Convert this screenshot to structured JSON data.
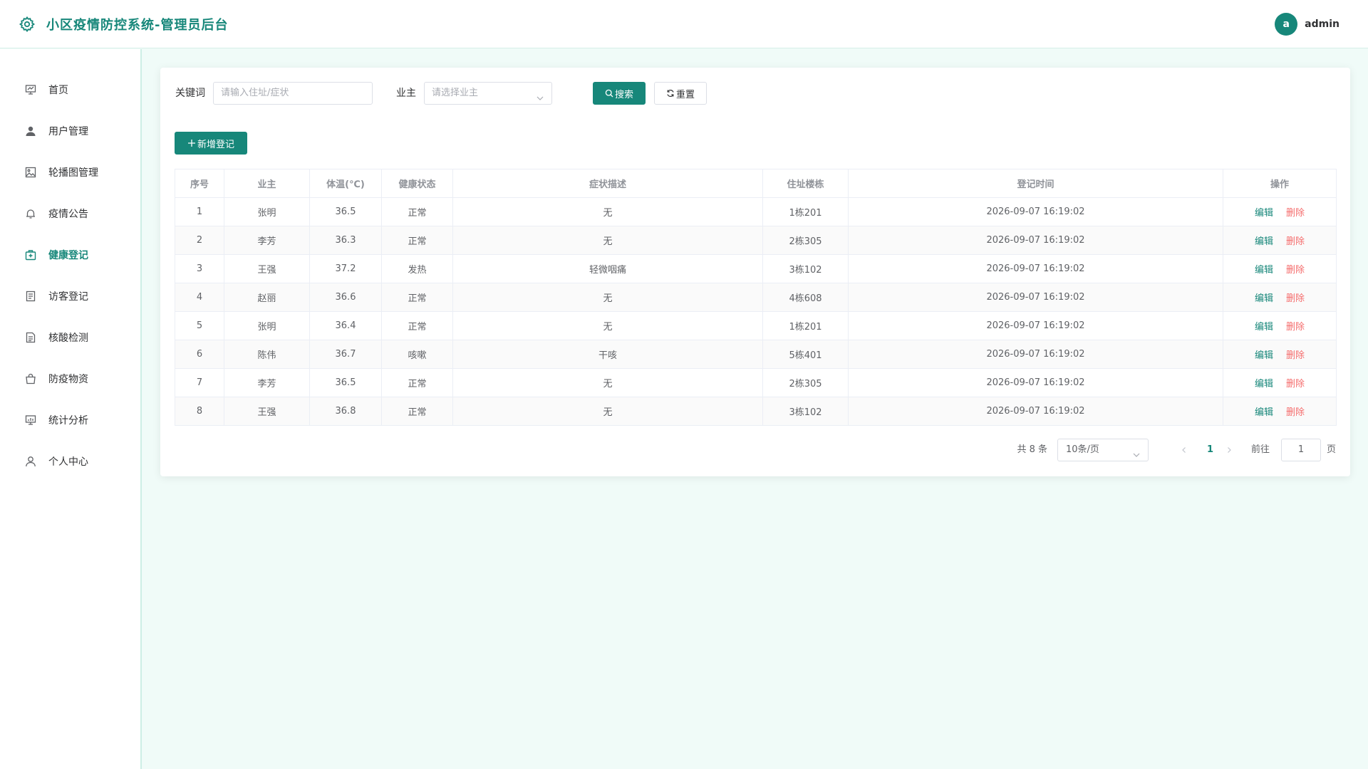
{
  "app": {
    "title": "小区疫情防控系统-管理员后台",
    "accent": "#17877a"
  },
  "user": {
    "avatar_letter": "a",
    "name": "admin"
  },
  "sidebar": {
    "items": [
      {
        "label": "首页",
        "icon": "dashboard-icon"
      },
      {
        "label": "用户管理",
        "icon": "user-icon"
      },
      {
        "label": "轮播图管理",
        "icon": "image-icon"
      },
      {
        "label": "疫情公告",
        "icon": "bell-icon"
      },
      {
        "label": "健康登记",
        "icon": "first-aid-kit-icon",
        "active": true
      },
      {
        "label": "访客登记",
        "icon": "document-icon"
      },
      {
        "label": "核酸检测",
        "icon": "tickets-icon"
      },
      {
        "label": "防疫物资",
        "icon": "bag-icon"
      },
      {
        "label": "统计分析",
        "icon": "data-analysis-icon"
      },
      {
        "label": "个人中心",
        "icon": "user-outline-icon"
      }
    ]
  },
  "search": {
    "keyword_label": "关键词",
    "keyword_placeholder": "请输入住址/症状",
    "owner_label": "业主",
    "owner_placeholder": "请选择业主",
    "search_button": "搜索",
    "reset_button": "重置"
  },
  "toolbar": {
    "add_button": "新增登记"
  },
  "table": {
    "headers": [
      "序号",
      "业主",
      "体温(℃)",
      "健康状态",
      "症状描述",
      "住址楼栋",
      "登记时间",
      "操作"
    ],
    "edit_label": "编辑",
    "delete_label": "删除",
    "rows": [
      [
        "1",
        "张明",
        "36.5",
        "正常",
        "无",
        "1栋201",
        "2026-09-07 16:19:02"
      ],
      [
        "2",
        "李芳",
        "36.3",
        "正常",
        "无",
        "2栋305",
        "2026-09-07 16:19:02"
      ],
      [
        "3",
        "王强",
        "37.2",
        "发热",
        "轻微咽痛",
        "3栋102",
        "2026-09-07 16:19:02"
      ],
      [
        "4",
        "赵丽",
        "36.6",
        "正常",
        "无",
        "4栋608",
        "2026-09-07 16:19:02"
      ],
      [
        "5",
        "张明",
        "36.4",
        "正常",
        "无",
        "1栋201",
        "2026-09-07 16:19:02"
      ],
      [
        "6",
        "陈伟",
        "36.7",
        "咳嗽",
        "干咳",
        "5栋401",
        "2026-09-07 16:19:02"
      ],
      [
        "7",
        "李芳",
        "36.5",
        "正常",
        "无",
        "2栋305",
        "2026-09-07 16:19:02"
      ],
      [
        "8",
        "王强",
        "36.8",
        "正常",
        "无",
        "3栋102",
        "2026-09-07 16:19:02"
      ]
    ]
  },
  "pagination": {
    "total": "共 8 条",
    "page_size": "10条/页",
    "current_page": "1",
    "goto_label": "前往",
    "goto_value": "1",
    "page_suffix": "页"
  }
}
